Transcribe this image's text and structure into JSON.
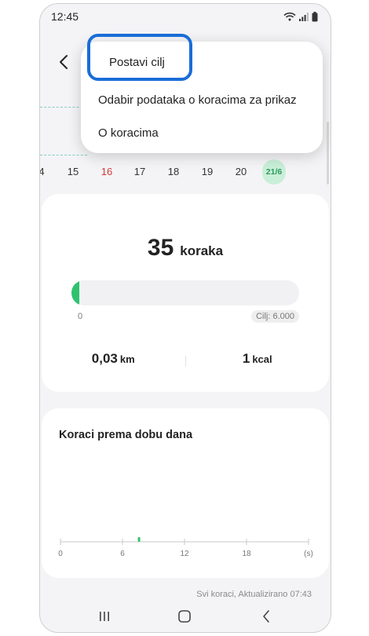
{
  "status_bar": {
    "time": "12:45"
  },
  "dates": {
    "items": [
      {
        "label": "4",
        "style": "normal"
      },
      {
        "label": "15",
        "style": "normal"
      },
      {
        "label": "16",
        "style": "red"
      },
      {
        "label": "17",
        "style": "normal"
      },
      {
        "label": "18",
        "style": "normal"
      },
      {
        "label": "19",
        "style": "normal"
      },
      {
        "label": "20",
        "style": "normal"
      },
      {
        "label": "21/6",
        "style": "selected"
      }
    ]
  },
  "summary": {
    "steps_value": "35",
    "steps_unit": "koraka",
    "progress_start": "0",
    "goal_label": "Cilj: 6.000",
    "progress_fraction": 0.006,
    "distance_value": "0,03",
    "distance_unit": "km",
    "calories_value": "1",
    "calories_unit": "kcal"
  },
  "time_of_day_chart": {
    "title": "Koraci prema dobu dana",
    "chart_data": {
      "type": "bar",
      "x_ticks": [
        "0",
        "6",
        "12",
        "18",
        "(s)"
      ],
      "xlim": [
        0,
        24
      ],
      "bars": [
        {
          "x": 7.6,
          "value": 35
        }
      ],
      "ylim": [
        0,
        1000
      ],
      "bar_color": "#2ec36e"
    }
  },
  "footer": {
    "note": "Svi koraci, Aktualizirano 07:43"
  },
  "popup_menu": {
    "items": [
      {
        "label": "Postavi cilj"
      },
      {
        "label": "Odabir podataka o koracima za prikaz"
      },
      {
        "label": "O koracima"
      }
    ]
  },
  "colors": {
    "accent_green": "#2ec36e",
    "highlight_blue": "#1a6dd8",
    "red_day": "#d23a3a"
  },
  "icons": {
    "back": "chevron-left-icon",
    "wifi": "wifi-icon",
    "signal": "signal-icon",
    "battery": "battery-icon",
    "recents": "recent-apps-icon",
    "home": "home-icon",
    "nav_back": "nav-back-icon"
  }
}
